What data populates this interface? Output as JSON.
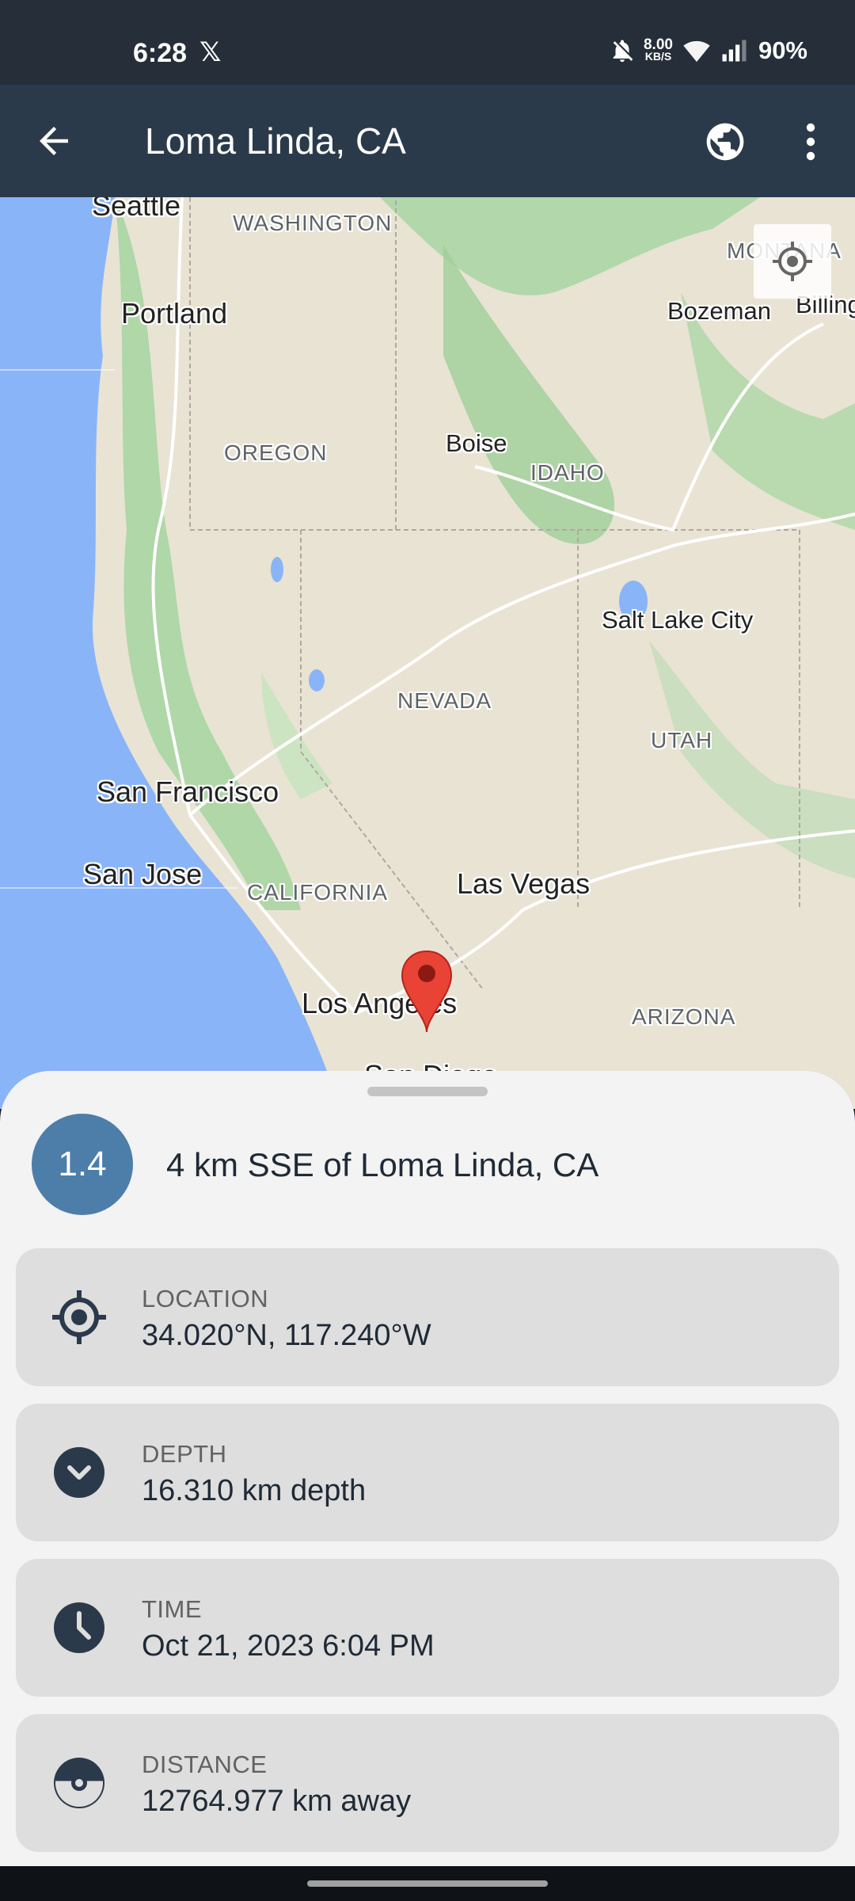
{
  "status_bar": {
    "time": "6:28",
    "x_logo": "𝕏",
    "net_speed_value": "8.00",
    "net_speed_unit": "KB/S",
    "battery": "90%",
    "icons": [
      "bell-off-icon",
      "wifi-icon",
      "cell-signal-icon"
    ]
  },
  "app_bar": {
    "title": "Loma Linda, CA",
    "icons": [
      "back-arrow-icon",
      "globe-icon",
      "more-vert-icon"
    ]
  },
  "map": {
    "cities": [
      "Seattle",
      "Portland",
      "Boise",
      "Bozeman",
      "Billings",
      "Salt Lake City",
      "San Francisco",
      "San Jose",
      "Las Vegas",
      "Los Angeles",
      "San Diego"
    ],
    "states": [
      "WASHINGTON",
      "OREGON",
      "IDAHO",
      "MONTANA",
      "NEVADA",
      "UTAH",
      "CALIFORNIA",
      "ARIZONA"
    ],
    "marker_color": "#e94335"
  },
  "earthquake": {
    "magnitude": "1.4",
    "title": "4 km SSE of Loma Linda, CA",
    "magnitude_color": "#4d7eaa",
    "details": [
      {
        "label": "LOCATION",
        "value": "34.020°N, 117.240°W",
        "icon": "location-target-icon"
      },
      {
        "label": "DEPTH",
        "value": "16.310 km depth",
        "icon": "depth-chevron-icon"
      },
      {
        "label": "TIME",
        "value": "Oct 21, 2023 6:04 PM",
        "icon": "clock-icon"
      },
      {
        "label": "DISTANCE",
        "value": "12764.977 km away",
        "icon": "distance-icon"
      }
    ]
  }
}
